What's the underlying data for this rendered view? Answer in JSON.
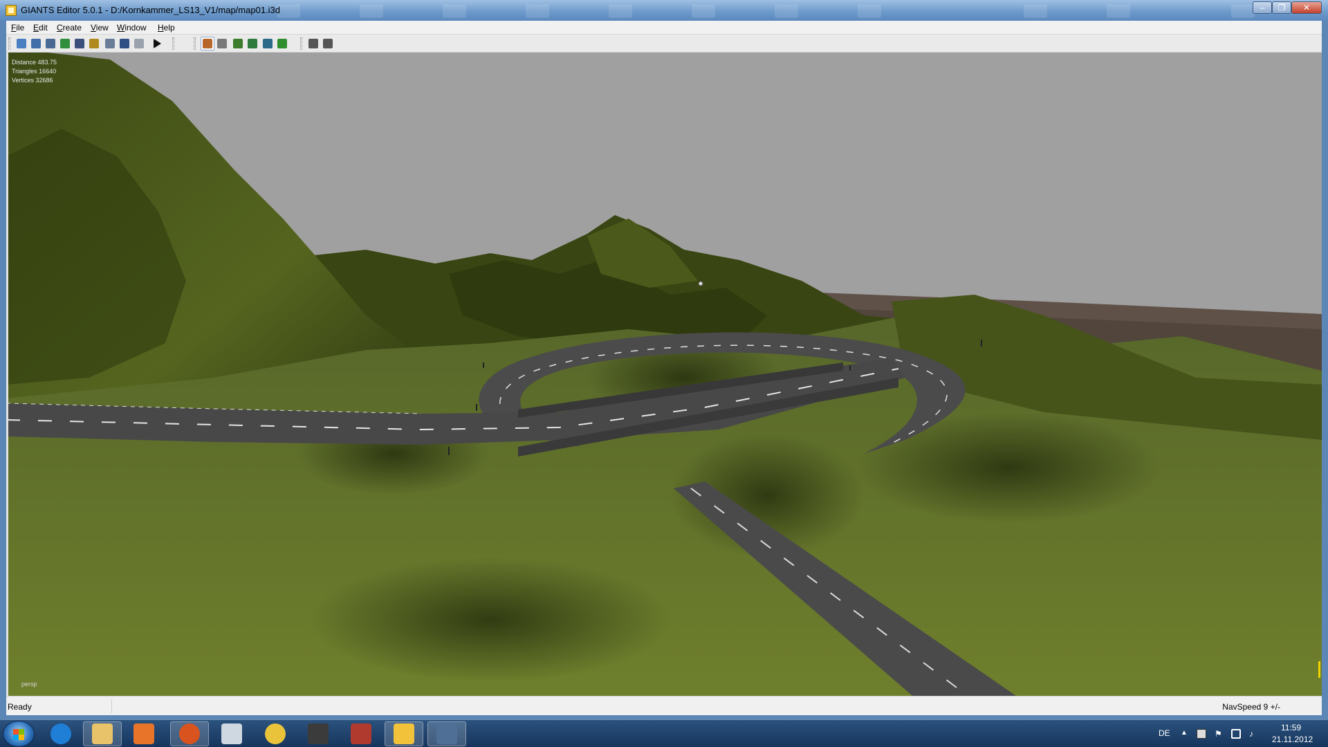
{
  "window": {
    "title": "GIANTS Editor 5.0.1 - D:/Kornkammer_LS13_V1/map/map01.i3d",
    "controls": [
      "–",
      "❐",
      "✕"
    ]
  },
  "menu": [
    "File",
    "Edit",
    "Create",
    "View",
    "Window",
    "Help"
  ],
  "toolbar": {
    "buttons": [
      {
        "name": "new-icon",
        "color": "#4a7fc1"
      },
      {
        "name": "open-icon",
        "color": "#3f6ea8"
      },
      {
        "name": "import-icon",
        "color": "#496b93"
      },
      {
        "name": "refresh-icon",
        "color": "#2f8f3c"
      },
      {
        "name": "save-icon",
        "color": "#3a4f7a"
      },
      {
        "name": "save-as-icon",
        "color": "#b08a1e"
      },
      {
        "name": "revert-icon",
        "color": "#6a7d98"
      },
      {
        "name": "undo-icon",
        "color": "#2f4f85"
      },
      {
        "name": "redo-icon",
        "color": "#9aa3ad"
      },
      {
        "name": "play-icon",
        "color": "#111111"
      },
      {
        "name": "select-icon",
        "color": "#b8672a"
      },
      {
        "name": "move-icon",
        "color": "#7a7a7a"
      },
      {
        "name": "terrain-sculpt-icon",
        "color": "#3b7d2a"
      },
      {
        "name": "terrain-paint-icon",
        "color": "#2f7a3d"
      },
      {
        "name": "terrain-smooth-icon",
        "color": "#2d6a8a"
      },
      {
        "name": "foliage-paint-icon",
        "color": "#2f8f2f"
      },
      {
        "name": "snap-icon",
        "color": "#555555"
      },
      {
        "name": "settings-icon",
        "color": "#555555"
      }
    ]
  },
  "viewport": {
    "stats": {
      "distance": "Distance 483.75",
      "triangles": "Triangles 16640",
      "vertices": "Vertices 32686"
    },
    "camera_label": "persp",
    "colors": {
      "sky": "#a0a0a0",
      "grass": "#48561c",
      "grass_light": "#6b7a2a",
      "grass_dark": "#2a330d",
      "soil": "#6a5a4c",
      "asphalt": "#4b4b4b",
      "bridge": "#3d3d3d"
    }
  },
  "statusbar": {
    "left": "Ready",
    "right": "NavSpeed 9 +/-"
  },
  "taskbar": {
    "apps": [
      {
        "name": "internet-explorer-icon",
        "color": "#1f7fd6",
        "open": false
      },
      {
        "name": "explorer-folder-icon",
        "color": "#e8c36a",
        "open": true
      },
      {
        "name": "media-player-icon",
        "color": "#e8742a",
        "open": false
      },
      {
        "name": "firefox-icon",
        "color": "#d9531e",
        "open": true
      },
      {
        "name": "calculator-icon",
        "color": "#cfd8e0",
        "open": false
      },
      {
        "name": "chrome-icon",
        "color": "#e9c43a",
        "open": false
      },
      {
        "name": "tractor-icon",
        "color": "#3b3b3b",
        "open": false
      },
      {
        "name": "farming-simulator-icon",
        "color": "#b03a2e",
        "open": false
      },
      {
        "name": "giants-editor-task-icon",
        "color": "#f2c23a",
        "open": true
      },
      {
        "name": "toolbox-icon",
        "color": "#4f6f96",
        "open": true
      }
    ],
    "language": "DE",
    "time": "11:59",
    "date": "21.11.2012"
  }
}
